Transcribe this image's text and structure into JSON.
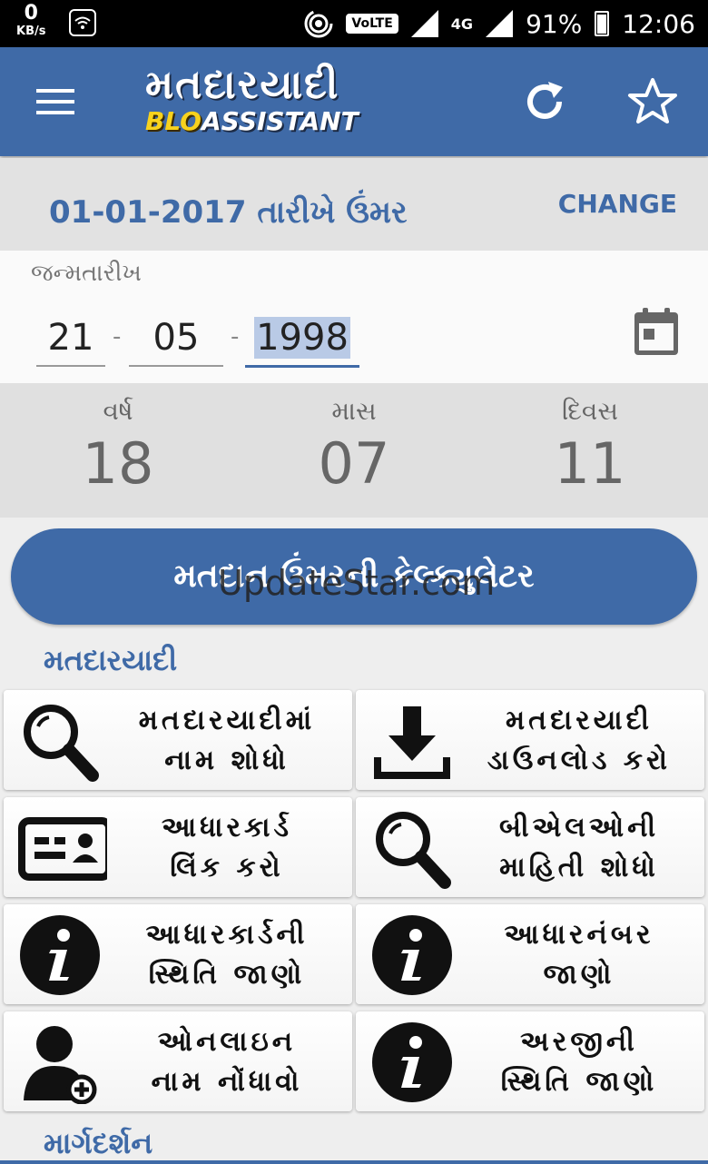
{
  "status_bar": {
    "net_speed": "0",
    "net_unit": "KB/s",
    "volte": "VoLTE",
    "network": "4G",
    "battery": "91%",
    "time": "12:06"
  },
  "app_bar": {
    "logo_title": "મતદારયાદી",
    "logo_blo": "BLO",
    "logo_assistant": "ASSISTANT"
  },
  "age_calc": {
    "title": "01-01-2017 તારીખે ઉંમર",
    "change_label": "CHANGE",
    "dob_label": "જન્મતારીખ",
    "day": "21",
    "month": "05",
    "year": "1998",
    "separator": "-",
    "years_label": "વર્ષ",
    "years_value": "18",
    "months_label": "માસ",
    "months_value": "07",
    "days_label": "દિવસ",
    "days_value": "11"
  },
  "calc_button_label": "મતદાન ઉંમરની કેલ્ક્યુલેટર",
  "watermark": "UpdateStar.com",
  "sections": {
    "voter_list": "મતદારયાદી",
    "guidance": "માર્ગદર્શન"
  },
  "tiles": [
    {
      "line1": "મતદારયાદીમાં",
      "line2": "નામ શોધો",
      "icon": "search-icon"
    },
    {
      "line1": "મતદારયાદી",
      "line2": "ડાઉનલોડ કરો",
      "icon": "download-icon"
    },
    {
      "line1": "આધારકાર્ડ",
      "line2": "લિંક કરો",
      "icon": "id-card-icon"
    },
    {
      "line1": "બીએલઓની",
      "line2": "માહિતી શોધો",
      "icon": "search-icon"
    },
    {
      "line1": "આધારકાર્ડની",
      "line2": "સ્થિતિ જાણો",
      "icon": "info-icon"
    },
    {
      "line1": "આધારનંબર",
      "line2": "જાણો",
      "icon": "info-icon"
    },
    {
      "line1": "ઓનલાઇન",
      "line2": "નામ નોંધાવો",
      "icon": "add-user-icon"
    },
    {
      "line1": "અરજીની",
      "line2": "સ્થિતિ જાણો",
      "icon": "info-icon"
    }
  ],
  "colors": {
    "primary": "#3f6aa7",
    "logo_accent": "#f7d21d"
  }
}
